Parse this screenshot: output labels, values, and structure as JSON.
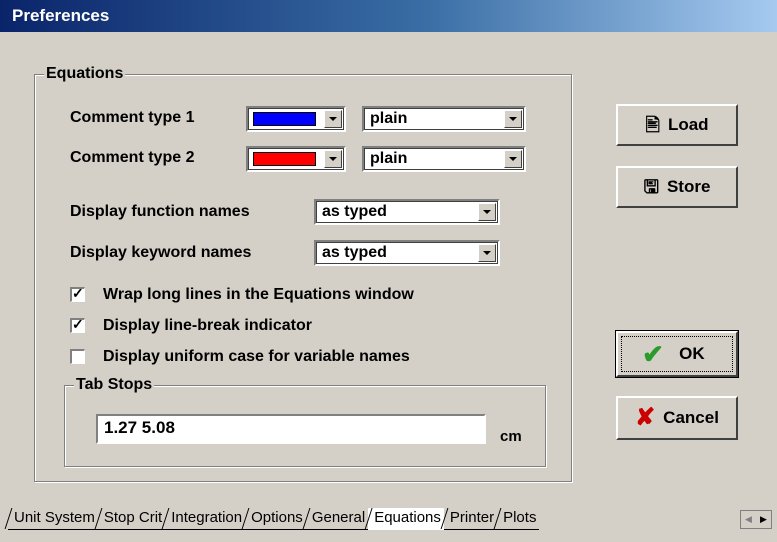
{
  "window": {
    "title": "Preferences"
  },
  "equations_group": {
    "label": "Equations",
    "comment_type_1": {
      "label": "Comment type 1",
      "color": "#0000ff",
      "style": "plain"
    },
    "comment_type_2": {
      "label": "Comment type 2",
      "color": "#ff0000",
      "style": "plain"
    },
    "display_function_names": {
      "label": "Display function names",
      "value": "as typed"
    },
    "display_keyword_names": {
      "label": "Display keyword names",
      "value": "as typed"
    },
    "checkboxes": [
      {
        "label": "Wrap long lines in the Equations window",
        "checked": true
      },
      {
        "label": "Display line-break indicator",
        "checked": true
      },
      {
        "label": "Display uniform case for variable names",
        "checked": false
      }
    ]
  },
  "tab_stops": {
    "label": "Tab Stops",
    "value": "1.27 5.08",
    "unit": "cm"
  },
  "buttons": {
    "load": "Load",
    "store": "Store",
    "ok": "OK",
    "cancel": "Cancel"
  },
  "icons": {
    "load": "load-icon",
    "store": "store-icon",
    "ok": "checkmark-icon",
    "cancel": "x-icon"
  },
  "tabs": [
    "Unit System",
    "Stop Crit",
    "Integration",
    "Options",
    "General",
    "Equations",
    "Printer",
    "Plots"
  ],
  "active_tab": "Equations"
}
